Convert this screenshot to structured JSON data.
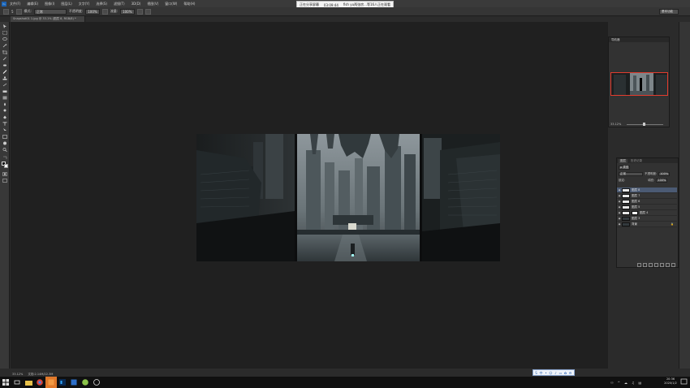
{
  "menubar": {
    "items": [
      "文件(F)",
      "编辑(E)",
      "图像(I)",
      "图层(L)",
      "文字(Y)",
      "选择(S)",
      "滤镜(T)",
      "3D(D)",
      "视图(V)",
      "窗口(W)",
      "帮助(H)"
    ]
  },
  "share_notice": {
    "status": "正在分享屏幕",
    "time": "03:09:44",
    "viewers": "fish yu两张房...等16人正在观看"
  },
  "options": {
    "mode_label": "模式:",
    "mode_value": "正常",
    "opacity_label": "不透明度:",
    "opacity_value": "100%",
    "flow_label": "流量:",
    "flow_value": "100%",
    "brush_size": "5",
    "workspace": "基本功能"
  },
  "document": {
    "tab_title": "Snapshot01 1.jpg @ 33.1% (图层 8, RGB/8) *"
  },
  "navigator": {
    "title": "导航器",
    "zoom": "33.12%"
  },
  "layers": {
    "tabs": [
      "图层",
      "历史记录"
    ],
    "kind_label": "ρ 类型",
    "blend_mode": "正常",
    "opacity_label": "不透明度:",
    "opacity_value": "100%",
    "lock_label": "锁定:",
    "fill_label": "填充:",
    "fill_value": "100%",
    "items": [
      {
        "name": "图层 8",
        "selected": true,
        "thumb": "light",
        "mask": false
      },
      {
        "name": "图层 7",
        "selected": false,
        "thumb": "light",
        "mask": false
      },
      {
        "name": "图层 6",
        "selected": false,
        "thumb": "light",
        "mask": false
      },
      {
        "name": "图层 5",
        "selected": false,
        "thumb": "light",
        "mask": false
      },
      {
        "name": "图层 4",
        "selected": false,
        "thumb": "light",
        "mask": true
      },
      {
        "name": "图层 3",
        "selected": false,
        "thumb": "dark",
        "mask": false
      },
      {
        "name": "背景",
        "selected": false,
        "thumb": "dark",
        "mask": false
      }
    ]
  },
  "status": {
    "zoom": "33.12%",
    "doc_size": "文档:2.14M/22.3M"
  },
  "clock": {
    "time": "20:36",
    "date": "2020/1/2"
  },
  "colors": {
    "accent_selection": "#4b5a73",
    "navigator_frame": "#e23c2e",
    "active_taskbar": "#e0782a"
  }
}
